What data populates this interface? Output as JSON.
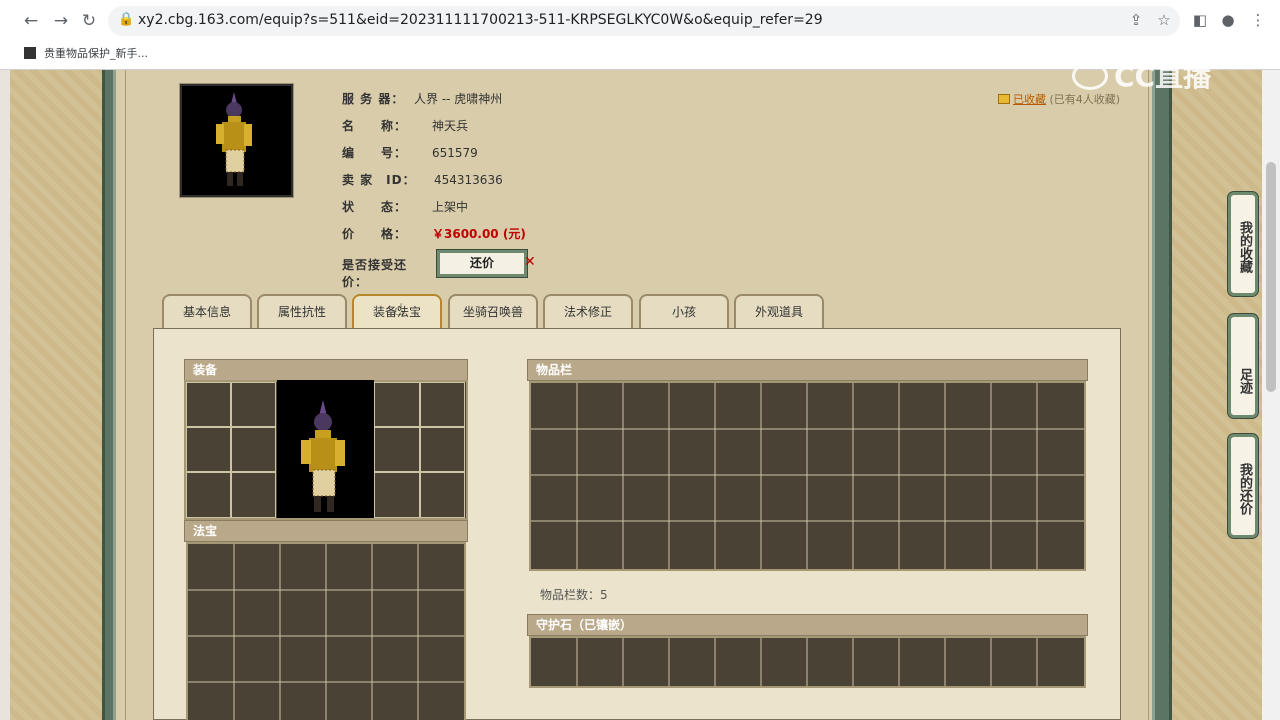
{
  "browser": {
    "url": "xy2.cbg.163.com/equip?s=511&eid=202311111700213-511-KRPSEGLKYC0W&o&equip_refer=29",
    "bookmark_label": "贵重物品保护_新手..."
  },
  "watermark": "CC直播",
  "item": {
    "server_label": "服 务 器：",
    "server_value": "人界 -- 虎啸神州",
    "name_label": "名　　称：",
    "name_value": "神天兵",
    "id_label": "编　　号：",
    "id_value": "651579",
    "seller_label": "卖 家　ID：",
    "seller_value": "454313636",
    "status_label": "状　　态：",
    "status_value": "上架中",
    "price_label": "价　　格：",
    "price_value": "￥3600.00 (元)",
    "bargain_label": "是否接受还价：",
    "bargain_button": "还价",
    "favorite_link": "已收藏",
    "favorite_count": "(已有4人收藏)"
  },
  "tabs": [
    {
      "label": "基本信息"
    },
    {
      "label": "属性抗性"
    },
    {
      "label": "装备法宝"
    },
    {
      "label": "坐骑召唤兽"
    },
    {
      "label": "法术修正"
    },
    {
      "label": "小孩"
    },
    {
      "label": "外观道具"
    }
  ],
  "sections": {
    "equip": "装备",
    "fabao": "法宝",
    "inventory": "物品栏",
    "inventory_count": "物品栏数：5",
    "guard_stone": "守护石（已镶嵌）"
  },
  "float_tabs": {
    "my_favorites": "我的收藏",
    "footprints": "足迹",
    "my_bargains": "我的还价"
  }
}
